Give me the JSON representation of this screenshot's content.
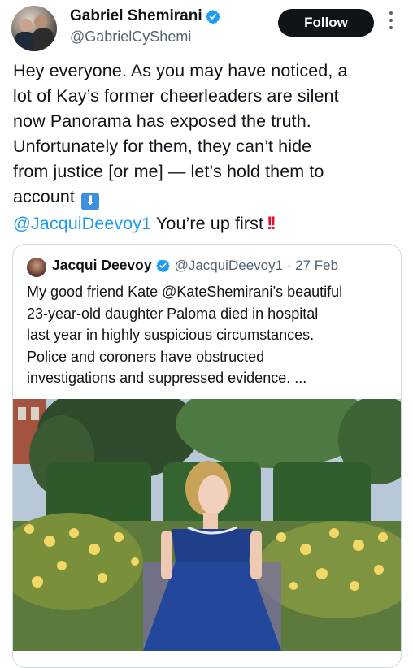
{
  "author": {
    "name": "Gabriel Shemirani",
    "handle": "@GabrielCyShemi",
    "follow_label": "Follow"
  },
  "tweet": {
    "lines": [
      "Hey everyone. As you may have noticed, a",
      "lot of Kay’s former cheerleaders are silent",
      "now Panorama has exposed the truth.",
      "Unfortunately for them, they can’t hide",
      "from justice [or me] — let’s hold them to",
      "account"
    ],
    "emoji_down": "⬇",
    "mention": "@JacquiDeevoy1",
    "after_mention": " You’re up first",
    "emoji_bang": "!!"
  },
  "quote": {
    "name": "Jacqui Deevoy",
    "handle_date": "@JacquiDeevoy1 · 27 Feb",
    "lines": [
      "My good friend Kate @KateShemirani’s beautiful",
      "23-year-old daughter Paloma died in hospital",
      "last year in highly suspicious circumstances.",
      "Police and coroners have obstructed",
      "investigations and suppressed evidence. ..."
    ]
  },
  "icons": {
    "verified": "verified-badge-icon",
    "more": "more-options-icon"
  },
  "colors": {
    "link": "#1d9bf0",
    "verified": "#1d9bf0",
    "button_bg": "#0f1419",
    "secondary_text": "#536471"
  }
}
